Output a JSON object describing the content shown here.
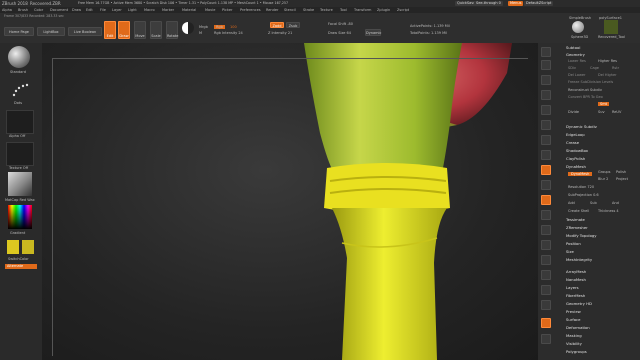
{
  "titlebar": {
    "app": "ZBrush 2018",
    "project": "Recovered.ZBR",
    "stats": "Free Mem 16.77GB • Active Mem 3680 • Scratch Disk 106 • Timer 1.31 • PolyCount 1.138 MP • MeshCount 1 • Mouse 167,257",
    "quicksave": "QuickSave",
    "seethrough": "See-through 0",
    "menus": "Menus",
    "defaultscript": "DefaultZScript"
  },
  "menubar": {
    "items": [
      "Alpha",
      "Brush",
      "Color",
      "Document",
      "Draw",
      "Edit",
      "File",
      "Layer",
      "Light",
      "Macro",
      "Marker",
      "Material",
      "Movie",
      "Picker",
      "Preferences",
      "Render",
      "Stencil",
      "Stroke",
      "Texture",
      "Tool",
      "Transform",
      "Zplugin",
      "Zscript"
    ]
  },
  "infobar": "Frame 307/833 Recorded: 283.33 sec",
  "shelf": {
    "home_page": "Home Page",
    "lightbox": "LightBox",
    "live_boolean": "Live Boolean",
    "edit": "Edit",
    "draw": "Draw",
    "move": "Move",
    "scale": "Scale",
    "rotate": "Rotate",
    "mrgb": "Mrgb",
    "rgb": "Rgb",
    "rgb_value": "100",
    "m": "M",
    "zadd": "Zadd",
    "zsub": "Zsub",
    "z_intensity": "Z Intensity 21",
    "rgb_intensity": "Rgb Intensity 24",
    "focal_shift": "Focal Shift -80",
    "draw_size": "Draw Size 64",
    "dynamic": "Dynamic",
    "active_points": "ActivePoints: 1.139 Mil",
    "total_points": "TotalPoints: 1.139 Mil"
  },
  "lefttray": {
    "brush": "Standard",
    "stroke": "Dots",
    "alpha": "Alpha Off",
    "texture": "Texture Off",
    "material": "MatCap Red Wax",
    "gradient": "Gradient",
    "switch_color": "SwitchColor",
    "alternate": "Alternate"
  },
  "rightdock": {
    "tool_top": "SimpleBrush",
    "tool_top2": "polySurface1",
    "tool_sphere": "Sphere3D",
    "tool_recovered": "Recovered_Tool",
    "items": [
      "BPR",
      "SPix 3",
      "Scroll",
      "Zoom",
      "Actual",
      "AAHalf",
      "Persp",
      "Floor",
      "Local",
      "L.Sym",
      "Frame",
      "Move",
      "Scale",
      "Rotate",
      "PolyF",
      "Transp",
      "Ghost",
      "Solo",
      "Xpose"
    ]
  },
  "toolpanel": {
    "subtool": "Subtool",
    "geometry": "Geometry",
    "lower_res": "Lower Res",
    "higher_res": "Higher Res",
    "sdiv": "SDiv",
    "cage": "Cage",
    "rstr": "Rstr",
    "del_lower": "Del Lower",
    "del_higher": "Del Higher",
    "freeze_subdiv": "Freeze SubDivision Levels",
    "reconstruct": "Reconstruct Subdiv",
    "convert_bpr": "Convert BPR To Geo",
    "smt": "Smt",
    "suv": "Suv",
    "reluv": "ReUV",
    "divide": "Divide",
    "dynamic_subdiv": "Dynamic Subdiv",
    "edgeloop": "EdgeLoop",
    "crease": "Crease",
    "shadowbox": "ShadowBox",
    "claypolish": "ClayPolish",
    "dynamesh_head": "DynaMesh",
    "dynamesh_btn": "DynaMesh",
    "groups": "Groups",
    "polish": "Polish",
    "blur": "Blur 2",
    "project": "Project",
    "resolution": "Resolution 720",
    "subprojection": "SubProjection 0.6",
    "add": "Add",
    "sub": "Sub",
    "and": "And",
    "create_shell": "Create Shell",
    "thickness": "Thickness 4",
    "tessimate": "Tessimate",
    "zremesher": "ZRemesher",
    "modify_topology": "Modify Topology",
    "position": "Position",
    "size": "Size",
    "meshintegrity": "MeshIntegrity",
    "arraymesh": "ArrayMesh",
    "nanomesh": "NanoMesh",
    "layers": "Layers",
    "fibermesh": "FiberMesh",
    "geometry_hd": "Geometry HD",
    "preview": "Preview",
    "surface": "Surface",
    "deformation": "Deformation",
    "masking": "Masking",
    "visibility": "Visibility",
    "polygroups": "Polygroups"
  },
  "colors": {
    "accent": "#e06a1a",
    "stem_yellow": "#e3e21a",
    "stem_green": "#8fae2a",
    "petal_red": "#c8414a"
  }
}
